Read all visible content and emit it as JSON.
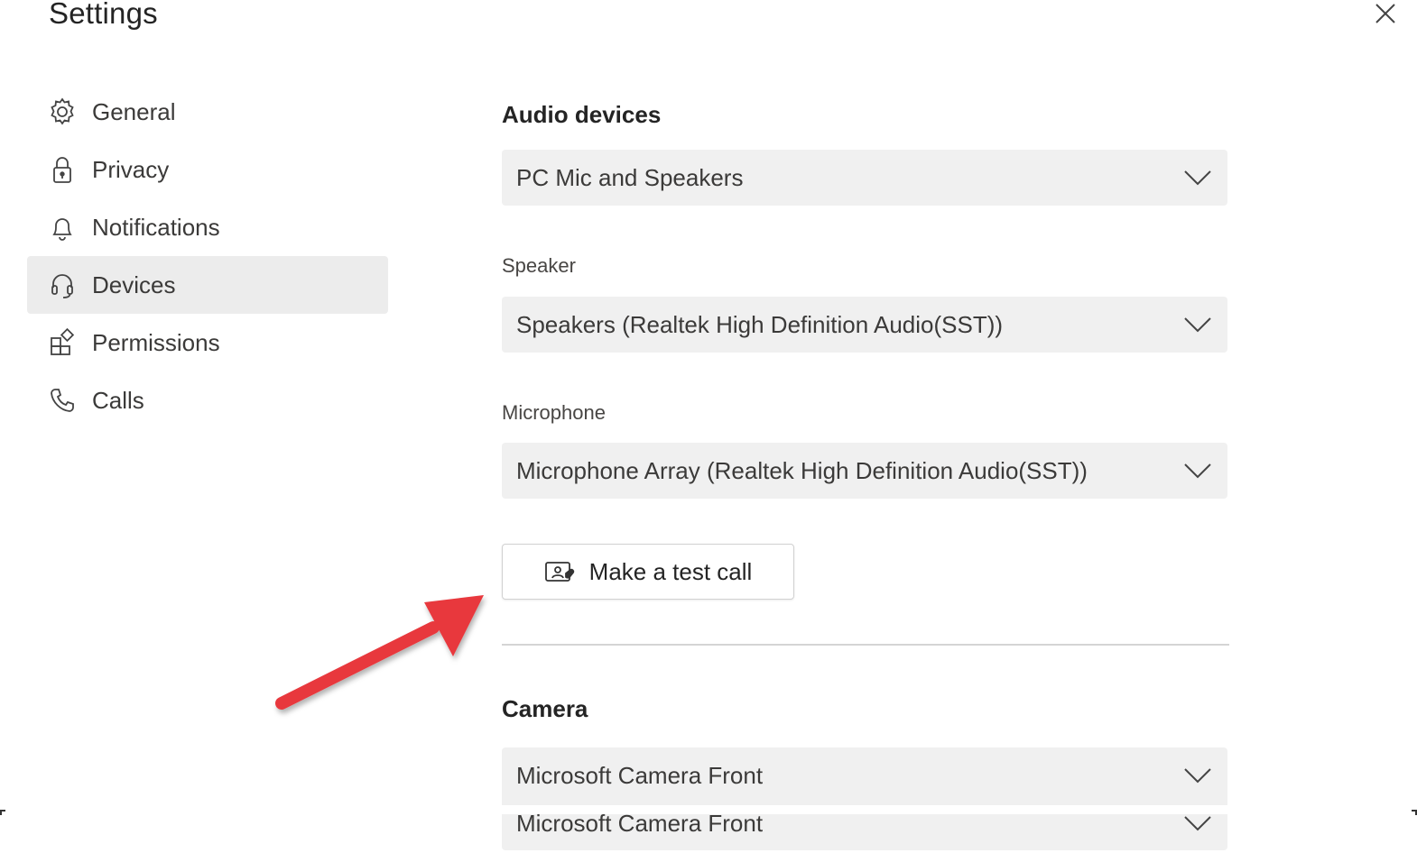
{
  "window": {
    "title": "Settings"
  },
  "nav": {
    "items": [
      {
        "label": "General",
        "icon": "gear-icon"
      },
      {
        "label": "Privacy",
        "icon": "lock-icon"
      },
      {
        "label": "Notifications",
        "icon": "bell-icon"
      },
      {
        "label": "Devices",
        "icon": "headset-icon",
        "active": true
      },
      {
        "label": "Permissions",
        "icon": "apps-icon"
      },
      {
        "label": "Calls",
        "icon": "phone-icon"
      }
    ]
  },
  "audio": {
    "heading": "Audio devices",
    "device_value": "PC Mic and Speakers",
    "speaker_label": "Speaker",
    "speaker_value": "Speakers (Realtek High Definition Audio(SST))",
    "microphone_label": "Microphone",
    "microphone_value": "Microphone Array (Realtek High Definition Audio(SST))",
    "test_call_label": "Make a test call"
  },
  "camera": {
    "heading": "Camera",
    "value": "Microsoft Camera Front",
    "value_repeat": "Microsoft Camera Front"
  },
  "colors": {
    "annotation_arrow": "#e8383d",
    "active_nav_bg": "#ececec",
    "dropdown_bg": "#f0f0f0"
  }
}
